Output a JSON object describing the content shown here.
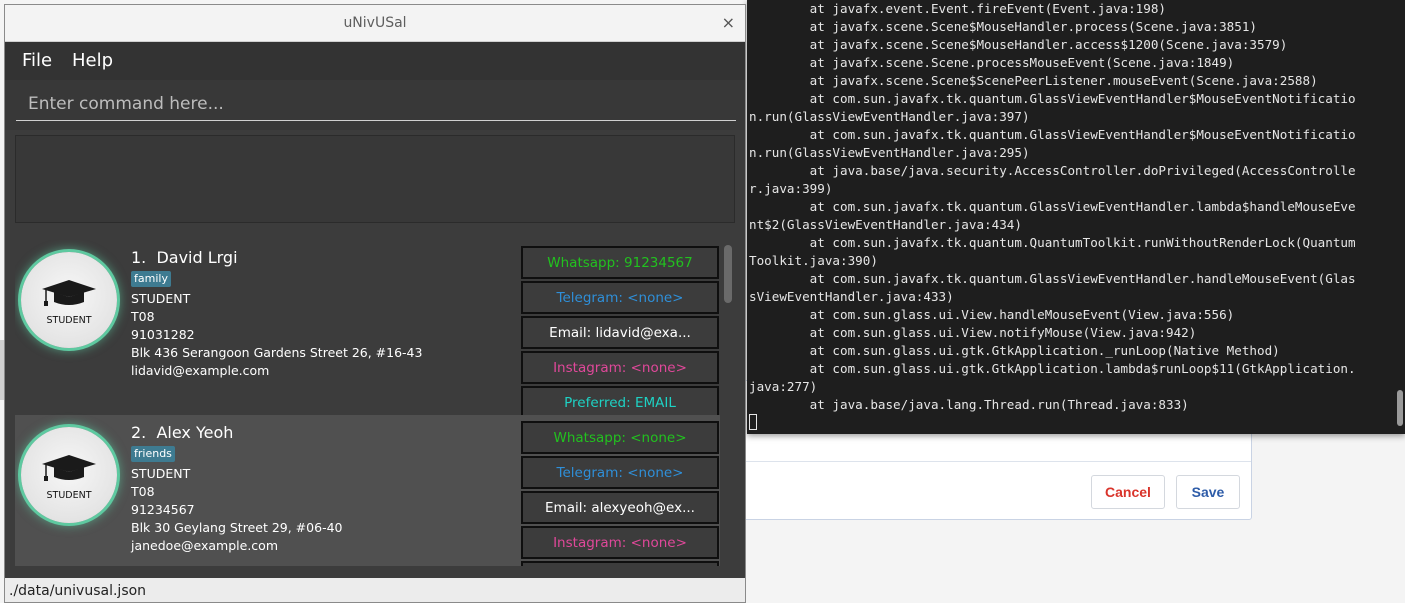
{
  "app": {
    "title": "uNivUSal",
    "close_glyph": "×",
    "menu": [
      "File",
      "Help"
    ],
    "command_placeholder": "Enter command here...",
    "status_path": "./data/univusal.json"
  },
  "persons": [
    {
      "index": "1.",
      "name": "David Lrgi",
      "tag": "family",
      "avatar_label": "STUDENT",
      "role": "STUDENT",
      "tutorial": "T08",
      "phone": "91031282",
      "address": "Blk 436 Serangoon Gardens Street 26, #16-43",
      "email": "lidavid@example.com",
      "contacts": {
        "whatsapp": "Whatsapp: 91234567",
        "telegram": "Telegram: <none>",
        "email": "Email: lidavid@exa...",
        "instagram": "Instagram: <none>",
        "preferred": "Preferred: EMAIL"
      }
    },
    {
      "index": "2.",
      "name": "Alex Yeoh",
      "tag": "friends",
      "avatar_label": "STUDENT",
      "role": "STUDENT",
      "tutorial": "T08",
      "phone": "91234567",
      "address": "Blk 30 Geylang Street 29, #06-40",
      "email": "janedoe@example.com",
      "contacts": {
        "whatsapp": "Whatsapp: <none>",
        "telegram": "Telegram: <none>",
        "email": "Email: alexyeoh@ex...",
        "instagram": "Instagram: <none>"
      }
    }
  ],
  "background_dialog": {
    "cancel_label": "Cancel",
    "save_label": "Save"
  },
  "terminal": {
    "lines": [
      "        at javafx.event.Event.fireEvent(Event.java:198)",
      "        at javafx.scene.Scene$MouseHandler.process(Scene.java:3851)",
      "        at javafx.scene.Scene$MouseHandler.access$1200(Scene.java:3579)",
      "        at javafx.scene.Scene.processMouseEvent(Scene.java:1849)",
      "        at javafx.scene.Scene$ScenePeerListener.mouseEvent(Scene.java:2588)",
      "        at com.sun.javafx.tk.quantum.GlassViewEventHandler$MouseEventNotificatio",
      "n.run(GlassViewEventHandler.java:397)",
      "        at com.sun.javafx.tk.quantum.GlassViewEventHandler$MouseEventNotificatio",
      "n.run(GlassViewEventHandler.java:295)",
      "        at java.base/java.security.AccessController.doPrivileged(AccessControlle",
      "r.java:399)",
      "        at com.sun.javafx.tk.quantum.GlassViewEventHandler.lambda$handleMouseEve",
      "nt$2(GlassViewEventHandler.java:434)",
      "        at com.sun.javafx.tk.quantum.QuantumToolkit.runWithoutRenderLock(Quantum",
      "Toolkit.java:390)",
      "        at com.sun.javafx.tk.quantum.GlassViewEventHandler.handleMouseEvent(Glas",
      "sViewEventHandler.java:433)",
      "        at com.sun.glass.ui.View.handleMouseEvent(View.java:556)",
      "        at com.sun.glass.ui.View.notifyMouse(View.java:942)",
      "        at com.sun.glass.ui.gtk.GtkApplication._runLoop(Native Method)",
      "        at com.sun.glass.ui.gtk.GtkApplication.lambda$runLoop$11(GtkApplication.",
      "java:277)",
      "        at java.base/java.lang.Thread.run(Thread.java:833)"
    ]
  },
  "colors": {
    "whatsapp": "#22c11f",
    "telegram": "#2f8fd8",
    "instagram": "#e0489a",
    "preferred": "#1ed2c4",
    "avatar_glow": "#5ec9a0",
    "tag_bg": "#3e7b91"
  }
}
